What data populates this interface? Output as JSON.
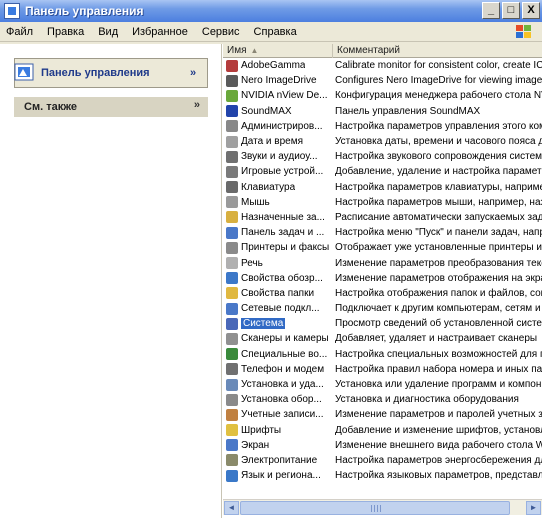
{
  "window": {
    "title": "Панель управления",
    "buttons": {
      "minimize": "_",
      "maximize": "□",
      "close": "X"
    }
  },
  "menu": {
    "items": [
      "Файл",
      "Правка",
      "Вид",
      "Избранное",
      "Сервис",
      "Справка"
    ]
  },
  "taskpane": {
    "control_panel_label": "Панель управления",
    "see_also_label": "См. также",
    "chevron": "»"
  },
  "list": {
    "columns": {
      "name": "Имя",
      "comment": "Комментарий",
      "sort_indicator": "▲"
    },
    "rows": [
      {
        "name": "AdobeGamma",
        "comment": "Calibrate monitor for consistent color, create IC",
        "icon": "adobe-gamma-icon",
        "color": "#b43c3c"
      },
      {
        "name": "Nero ImageDrive",
        "comment": "Configures Nero ImageDrive for viewing image",
        "icon": "nero-icon",
        "color": "#5a5a5a"
      },
      {
        "name": "NVIDIA nView De...",
        "comment": "Конфигурация менеджера рабочего стола NV",
        "icon": "nvidia-icon",
        "color": "#6aa83a"
      },
      {
        "name": "SoundMAX",
        "comment": "Панель управления SoundMAX",
        "icon": "soundmax-icon",
        "color": "#2244aa"
      },
      {
        "name": "Администриров...",
        "comment": "Настройка параметров управления этого ком",
        "icon": "admin-tools-icon",
        "color": "#888888"
      },
      {
        "name": "Дата и время",
        "comment": "Установка даты, времени и часового пояса д",
        "icon": "clock-icon",
        "color": "#a0a0a0"
      },
      {
        "name": "Звуки и аудиоу...",
        "comment": "Настройка звукового сопровождения систем",
        "icon": "speaker-icon",
        "color": "#707070"
      },
      {
        "name": "Игровые устрой...",
        "comment": "Добавление, удаление и настройка параметр",
        "icon": "gamepad-icon",
        "color": "#7a7a7a"
      },
      {
        "name": "Клавиатура",
        "comment": "Настройка параметров клавиатуры, наприме",
        "icon": "keyboard-icon",
        "color": "#6a6a6a"
      },
      {
        "name": "Мышь",
        "comment": "Настройка параметров мыши, например, наз",
        "icon": "mouse-icon",
        "color": "#9a9a9a"
      },
      {
        "name": "Назначенные за...",
        "comment": "Расписание автоматически запускаемых зад",
        "icon": "scheduled-tasks-icon",
        "color": "#d8b040"
      },
      {
        "name": "Панель задач и ...",
        "comment": "Настройка меню \"Пуск\" и панели задач, напр",
        "icon": "taskbar-icon",
        "color": "#4a78c8"
      },
      {
        "name": "Принтеры и факсы",
        "comment": "Отображает уже установленные принтеры и",
        "icon": "printer-icon",
        "color": "#8a8a8a"
      },
      {
        "name": "Речь",
        "comment": "Изменение параметров преобразования текс",
        "icon": "speech-icon",
        "color": "#b0b0b0"
      },
      {
        "name": "Свойства обозр...",
        "comment": "Изменение параметров отображения на экра",
        "icon": "internet-options-icon",
        "color": "#3c78c8"
      },
      {
        "name": "Свойства папки",
        "comment": "Настройка отображения папок и файлов, сом",
        "icon": "folder-icon",
        "color": "#e0b840"
      },
      {
        "name": "Сетевые подкл...",
        "comment": "Подключает к другим компьютерам, сетям и",
        "icon": "network-icon",
        "color": "#4a78c8"
      },
      {
        "name": "Система",
        "comment": "Просмотр сведений об установленной систем",
        "icon": "system-icon",
        "color": "#4a68b8"
      },
      {
        "name": "Сканеры и камеры",
        "comment": "Добавляет, удаляет и настраивает сканеры",
        "icon": "scanner-icon",
        "color": "#909090"
      },
      {
        "name": "Специальные во...",
        "comment": "Настройка специальных возможностей для п",
        "icon": "accessibility-icon",
        "color": "#3a8a3a"
      },
      {
        "name": "Телефон и модем",
        "comment": "Настройка правил набора номера и иных пар",
        "icon": "phone-icon",
        "color": "#707070"
      },
      {
        "name": "Установка и уда...",
        "comment": "Установка или удаление программ и компон",
        "icon": "add-remove-icon",
        "color": "#6a8ab8"
      },
      {
        "name": "Установка обор...",
        "comment": "Установка и диагностика оборудования",
        "icon": "hardware-icon",
        "color": "#8a8a8a"
      },
      {
        "name": "Учетные записи...",
        "comment": "Изменение параметров и паролей учетных за",
        "icon": "users-icon",
        "color": "#c08040"
      },
      {
        "name": "Шрифты",
        "comment": "Добавление и изменение шрифтов, установл",
        "icon": "fonts-icon",
        "color": "#e0c040"
      },
      {
        "name": "Экран",
        "comment": "Изменение внешнего вида рабочего стола W",
        "icon": "display-icon",
        "color": "#4a78c8"
      },
      {
        "name": "Электропитание",
        "comment": "Настройка параметров энергосбережения дл",
        "icon": "power-icon",
        "color": "#8a8a6a"
      },
      {
        "name": "Язык и региона...",
        "comment": "Настройка языковых параметров, представл",
        "icon": "language-icon",
        "color": "#3a78c8"
      }
    ],
    "selected_index": 17
  },
  "scrollbar": {
    "left_arrow": "◄",
    "right_arrow": "►"
  }
}
